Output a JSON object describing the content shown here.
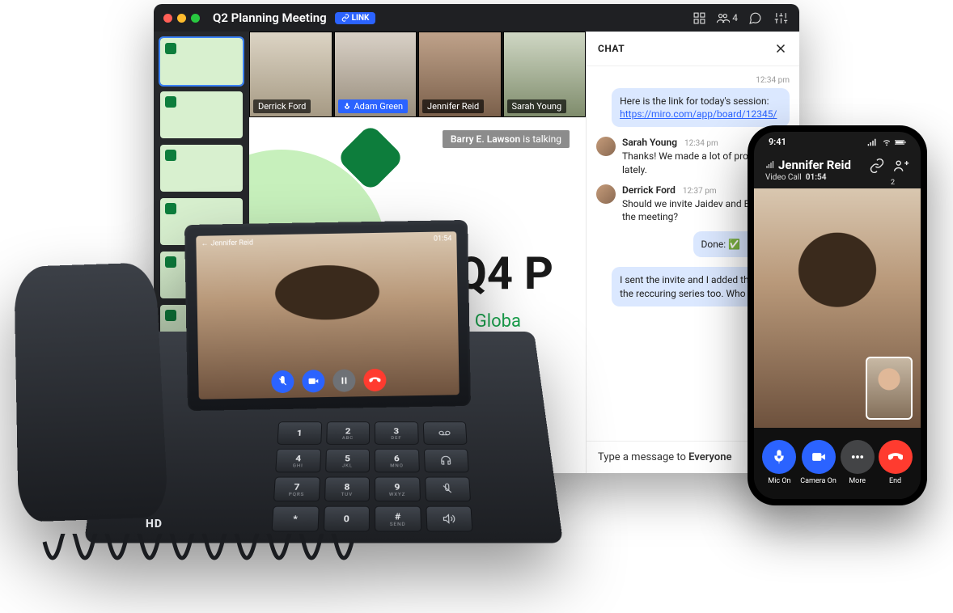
{
  "meeting": {
    "title": "Q2 Planning Meeting",
    "link_badge": "LINK",
    "people_count": "4",
    "participants": [
      {
        "name": "Derrick Ford"
      },
      {
        "name": "Adam Green",
        "speaking": true
      },
      {
        "name": "Jennifer Reid"
      },
      {
        "name": "Sarah Young"
      }
    ],
    "talking": {
      "name": "Barry E. Lawson",
      "suffix": "is talking"
    },
    "slide": {
      "title": "Q4 P",
      "subtitle": "Globa"
    }
  },
  "chat": {
    "header": "CHAT",
    "outgoing_ts": "12:34 pm",
    "msg1_pre": "Here is the link for today's session: ",
    "msg1_link": "https://miro.com/app/board/12345/",
    "thread": [
      {
        "who": "Sarah Young",
        "when": "12:34 pm",
        "text": "Thanks! We made a lot of progress lately."
      },
      {
        "who": "Derrick Ford",
        "when": "12:37 pm",
        "text": "Should we invite Jaidev and Evelyn to the meeting?"
      }
    ],
    "out2": "Done: ✅",
    "out3": "I sent the invite and I added them to the reccuring series too. Who else?",
    "input_pre": "Type a message to ",
    "input_target": "Everyone"
  },
  "phone": {
    "time": "9:41",
    "participants_count": "2",
    "name": "Jennifer Reid",
    "sub_label": "Video Call",
    "sub_time": "01:54",
    "buttons": {
      "mic": "Mic On",
      "cam": "Camera On",
      "more": "More",
      "end": "End"
    }
  },
  "desk_phone": {
    "hd": "HD",
    "screen_name": "Jennifer Reid",
    "screen_time": "01:54",
    "keys": [
      {
        "n": "1",
        "l": ""
      },
      {
        "n": "2",
        "l": "ABC"
      },
      {
        "n": "3",
        "l": "DEF"
      },
      {
        "icon": "voicemail"
      },
      {
        "n": "4",
        "l": "GHI"
      },
      {
        "n": "5",
        "l": "JKL"
      },
      {
        "n": "6",
        "l": "MNO"
      },
      {
        "icon": "headset"
      },
      {
        "n": "7",
        "l": "PQRS"
      },
      {
        "n": "8",
        "l": "TUV"
      },
      {
        "n": "9",
        "l": "WXYZ"
      },
      {
        "icon": "mute"
      },
      {
        "n": "*",
        "l": ""
      },
      {
        "n": "0",
        "l": ""
      },
      {
        "n": "#",
        "l": "SEND"
      },
      {
        "icon": "speaker"
      }
    ]
  }
}
